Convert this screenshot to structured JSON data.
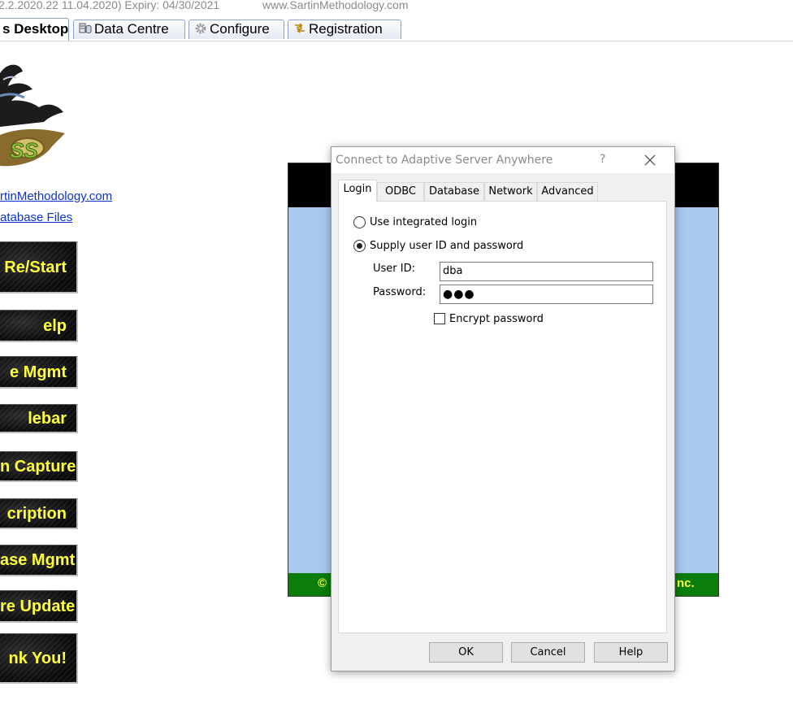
{
  "window": {
    "version_text": "2.2.2020.22  11.04.2020)  Expiry: 04/30/2021",
    "website": "www.SartinMethodology.com"
  },
  "main_tabs": [
    {
      "label": "s Desktop",
      "active": true
    },
    {
      "label": "Data Centre",
      "icon": "database-icon"
    },
    {
      "label": "Configure",
      "icon": "gear-icon"
    },
    {
      "label": "Registration",
      "icon": "registration-icon"
    }
  ],
  "left_links": [
    "rtinMethodology.com",
    "atabase Files"
  ],
  "nav_buttons": [
    "Re/Start",
    "elp",
    "e Mgmt",
    "lebar",
    "n Capture",
    "cription",
    "ase Mgmt",
    "re Update",
    "nk You!"
  ],
  "splash": {
    "footer_left": "©",
    "footer_right": "nc."
  },
  "dialog": {
    "title": "Connect to Adaptive Server Anywhere",
    "help_glyph": "?",
    "tabs": [
      "Login",
      "ODBC",
      "Database",
      "Network",
      "Advanced"
    ],
    "active_tab": "Login",
    "login": {
      "integrated_label": "Use integrated login",
      "supply_label": "Supply user ID and password",
      "selected_option": "supply",
      "user_id_label": "User ID:",
      "user_id_value": "dba",
      "password_label": "Password:",
      "password_mask": "●●●",
      "encrypt_label": "Encrypt password",
      "encrypt_checked": false
    },
    "buttons": {
      "ok": "OK",
      "cancel": "Cancel",
      "help": "Help"
    }
  },
  "colors": {
    "nav_text": "#ffff3a",
    "link": "#0b33c9",
    "splash_body": "#a9c8ee",
    "splash_footer": "#0a7d0a"
  }
}
